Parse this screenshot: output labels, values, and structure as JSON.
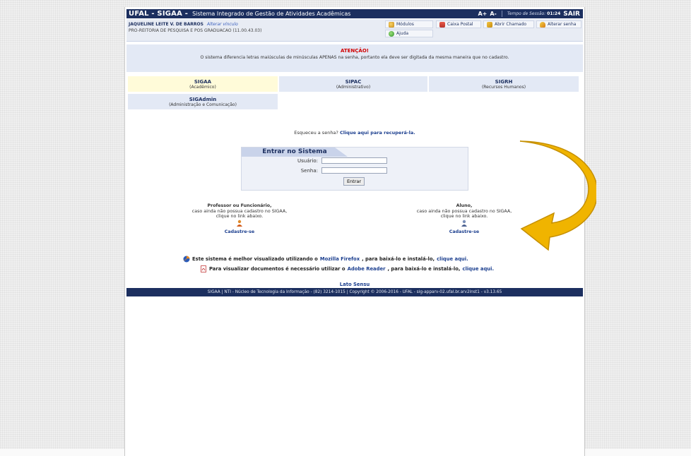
{
  "header": {
    "brand": "UFAL - SIGAA -",
    "subtitle": "Sistema Integrado de Gestão de Atividades Acadêmicas",
    "font_increase": "A+",
    "font_decrease": "A-",
    "session_label": "Tempo de Sessão:",
    "session_time": "01:24",
    "exit": "SAIR"
  },
  "user": {
    "name": "JAQUELINE LEITE V. DE BARROS",
    "change_link": "Alterar vínculo",
    "department": "PRO-REITORIA DE PESQUISA E POS GRADUACAO (11.00.43.03)"
  },
  "toolbar": {
    "modules": "Módulos",
    "help": "Ajuda",
    "mailbox": "Caixa Postal",
    "open_ticket": "Abrir Chamado",
    "change_password": "Alterar senha"
  },
  "alert": {
    "title": "ATENÇÃO!",
    "message": "O sistema diferencia letras maiúsculas de minúsculas APENAS na senha, portanto ela deve ser digitada da mesma maneira que no cadastro."
  },
  "systems": [
    {
      "name": "SIGAA",
      "desc": "(Acadêmico)"
    },
    {
      "name": "SIPAC",
      "desc": "(Administrativo)"
    },
    {
      "name": "SIGRH",
      "desc": "(Recursos Humanos)"
    },
    {
      "name": "SIGAdmin",
      "desc": "(Administração e Comunicação)"
    }
  ],
  "forgot": {
    "text": "Esqueceu a senha?",
    "link": "Clique aqui para recuperá-la."
  },
  "login": {
    "title": "Entrar no Sistema",
    "user_label": "Usuário:",
    "user_value": "",
    "password_label": "Senha:",
    "password_value": "",
    "submit": "Entrar"
  },
  "signup_staff": {
    "heading": "Professor ou Funcionário,",
    "line1": "caso ainda não possua cadastro no SIGAA,",
    "line2": "clique no link abaixo.",
    "link": "Cadastre-se"
  },
  "signup_student": {
    "heading": "Aluno,",
    "line1": "caso ainda não possua cadastro no SIGAA,",
    "line2": "clique no link abaixo.",
    "link": "Cadastre-se"
  },
  "notes": {
    "firefox_pre": "Este sistema é melhor visualizado utilizando o",
    "firefox_link": "Mozilla Firefox",
    "firefox_mid": ", para baixá-lo e instalá-lo,",
    "firefox_click": "clique aqui.",
    "reader_pre": "Para visualizar documentos é necessário utilizar o",
    "reader_link": "Adobe Reader",
    "reader_mid": ", para baixá-lo e instalá-lo,",
    "reader_click": "clique aqui."
  },
  "lato_sensu": "Lato Sensu",
  "footer": "SIGAA | NTI - Núcleo de Tecnologia da Informação - (82) 3214-1015 | Copyright © 2006-2016 - UFAL - sig-apparv-02.ufal.br.arv2inst1 - v3.13.65",
  "colors": {
    "navy": "#1c2f5f",
    "alert_red": "#d10000",
    "arrow": "#f0b400"
  }
}
